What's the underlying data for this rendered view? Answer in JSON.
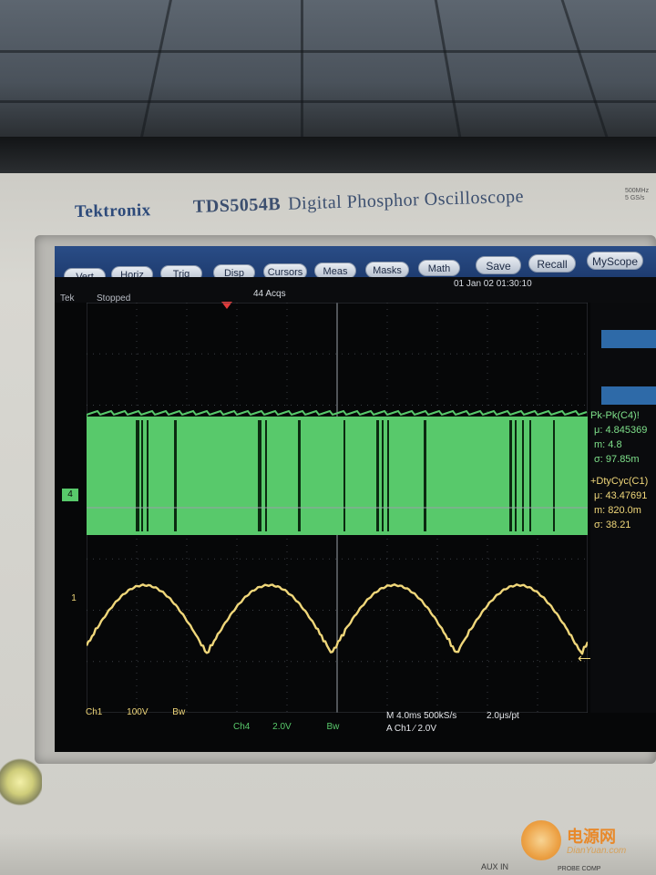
{
  "instrument": {
    "brand": "Tektronix",
    "model": "TDS5054B",
    "title": "Digital Phosphor Oscilloscope",
    "spec_corner": [
      "500MHz",
      "5 GS/s"
    ]
  },
  "menu": [
    "Vert",
    "Horiz",
    "Trig",
    "Disp",
    "Cursors",
    "Meas",
    "Masks",
    "Math",
    "Save",
    "Recall",
    "MyScope"
  ],
  "status": {
    "brand": "Tek",
    "state": "Stopped",
    "acqs": "44 Acqs",
    "datetime": "01 Jan 02 01:30:10"
  },
  "measurements": [
    {
      "label": "Pk-Pk(C4)!",
      "mu": "μ: 4.845369",
      "m": "m: 4.8",
      "sigma": "σ: 97.85m"
    },
    {
      "label": "+DtyCyc(C1)",
      "mu": "μ: 43.47691",
      "m": "m: 820.0m",
      "sigma": "σ: 38.21"
    }
  ],
  "channels": {
    "ch1": {
      "name": "Ch1",
      "scale": "100V",
      "bw": "Bw",
      "marker": "1"
    },
    "ch4": {
      "name": "Ch4",
      "scale": "2.0V",
      "bw": "Bw",
      "marker": "4"
    }
  },
  "timebase": {
    "main": "M 4.0ms 500kS/s",
    "per_pt": "2.0μs/pt",
    "trigger": "A  Ch1  ⁄  2.0V"
  },
  "watermark": {
    "text": "电源网",
    "sub": "DianYuan.com"
  },
  "lower_panel": {
    "aux": "AUX IN",
    "probe": "PROBE COMP"
  },
  "colors": {
    "ch1": "#f0d77a",
    "ch4": "#58c96b",
    "menubar": "#1e3c70"
  }
}
